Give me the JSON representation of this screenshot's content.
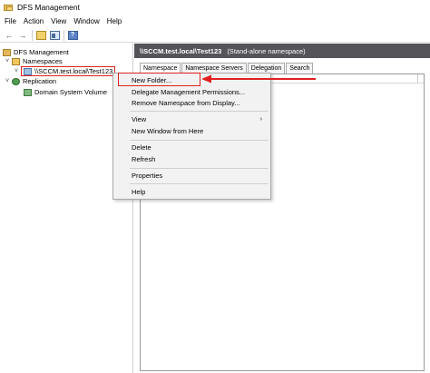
{
  "window": {
    "title": "DFS Management"
  },
  "menu": [
    "File",
    "Action",
    "View",
    "Window",
    "Help"
  ],
  "toolbar": {
    "icons": [
      "back-arrow-icon",
      "forward-arrow-icon",
      "up-folder-icon",
      "show-hide-tree-icon",
      "help-icon"
    ]
  },
  "tree": {
    "root": "DFS Management",
    "namespaces": "Namespaces",
    "namespace_item": "\\\\SCCM.test.local\\Test123",
    "replication": "Replication",
    "replication_child": "Domain System Volume"
  },
  "right_pane": {
    "namespace_path": "\\\\SCCM.test.local\\Test123",
    "namespace_type": "(Stand-alone namespace)",
    "tabs": [
      "Namespace",
      "Namespace Servers",
      "Delegation",
      "Search"
    ]
  },
  "context_menu": {
    "items": [
      {
        "label": "New Folder..."
      },
      {
        "label": "Delegate Management Permissions..."
      },
      {
        "label": "Remove Namespace from Display..."
      },
      {
        "label": "View",
        "submenu_glyph": "›"
      },
      {
        "label": "New Window from Here"
      },
      {
        "label": "Delete"
      },
      {
        "label": "Refresh"
      },
      {
        "label": "Properties"
      },
      {
        "label": "Help"
      }
    ]
  },
  "colors": {
    "annotation_red": "#e02020",
    "header_band": "#54545a",
    "menu_bg": "#f2f2f2"
  }
}
